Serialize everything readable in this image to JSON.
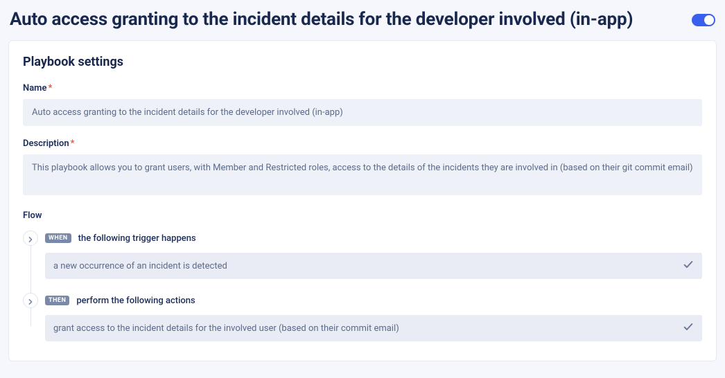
{
  "header": {
    "title": "Auto access granting to the incident details for the developer involved (in-app)",
    "toggle_on": true
  },
  "card": {
    "title": "Playbook settings",
    "fields": {
      "name_label": "Name",
      "name_value": "Auto access granting to the incident details for the developer involved (in-app)",
      "description_label": "Description",
      "description_value": "This playbook allows you to grant users, with Member and Restricted roles, access to the details of the incidents they are involved in (based on their git commit email)",
      "flow_label": "Flow"
    },
    "flow": [
      {
        "badge": "WHEN",
        "head_text": "the following trigger happens",
        "body_text": "a new occurrence of an incident is detected"
      },
      {
        "badge": "THEN",
        "head_text": "perform the following actions",
        "body_text": "grant access to the incident details for the involved user (based on their commit email)"
      }
    ]
  }
}
